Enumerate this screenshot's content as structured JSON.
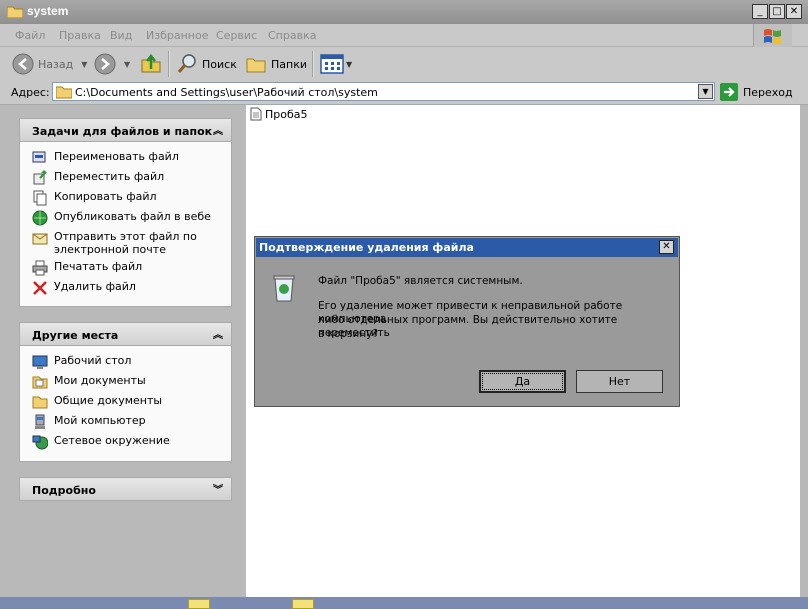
{
  "window": {
    "title": "system"
  },
  "menu": [
    "Файл",
    "Правка",
    "Вид",
    "Избранное",
    "Сервис",
    "Справка"
  ],
  "toolbar": {
    "back": "Назад",
    "search": "Поиск",
    "folders": "Папки"
  },
  "address": {
    "label": "Адрес:",
    "path": "C:\\Documents and Settings\\user\\Рабочий стол\\system",
    "go": "Переход"
  },
  "tasks_panel": {
    "title": "Задачи для файлов и папок",
    "items": [
      "Переименовать файл",
      "Переместить файл",
      "Копировать файл",
      "Опубликовать файл в вебе",
      "Отправить этот файл по",
      "электронной почте",
      "Печатать файл",
      "Удалить файл"
    ]
  },
  "places_panel": {
    "title": "Другие места",
    "items": [
      "Рабочий стол",
      "Мои документы",
      "Общие документы",
      "Мой компьютер",
      "Сетевое окружение"
    ]
  },
  "details_panel": {
    "title": "Подробно"
  },
  "file": {
    "name": "Проба5"
  },
  "dialog": {
    "title": "Подтверждение удаления файла",
    "line1": "Файл \"Проба5\" является системным.",
    "line2": "Его удаление может привести к неправильной работе компьютера",
    "line3": "либо отдельных программ. Вы действительно хотите переместить",
    "line4": "в корзину?",
    "yes": "Да",
    "no": "Нет"
  },
  "colors": {
    "dialog_title_bar": "#2a5aa8",
    "content_bg": "#ffffff"
  }
}
